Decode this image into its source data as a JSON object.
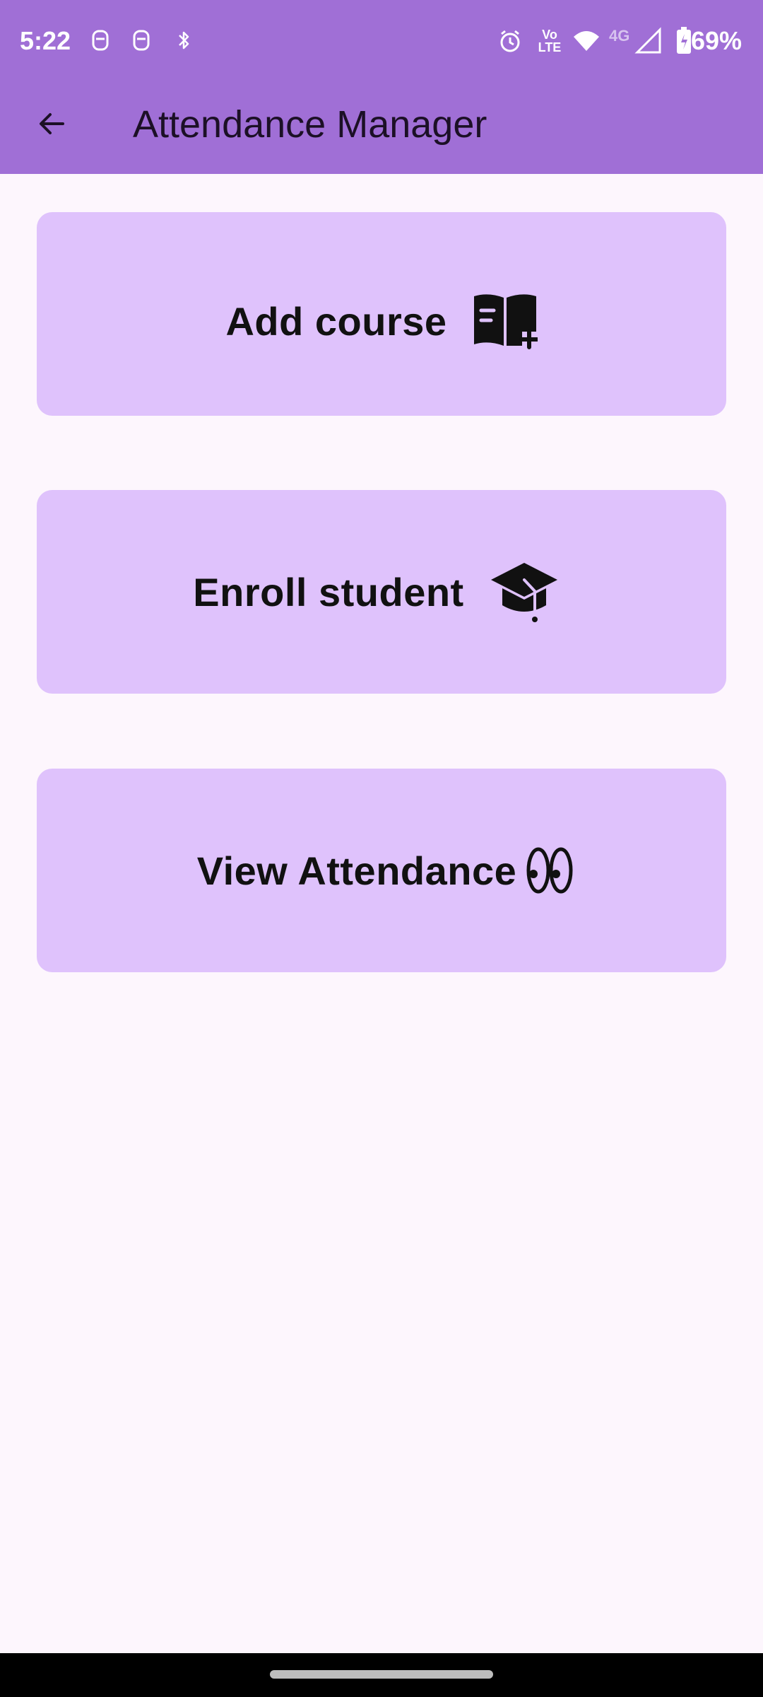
{
  "status_bar": {
    "time": "5:22",
    "network_label": "4G",
    "volte_label": "Vo LTE",
    "battery": "69%"
  },
  "app_bar": {
    "title": "Attendance Manager",
    "back_icon": "arrow-back-icon"
  },
  "menu": [
    {
      "label": "Add course",
      "icon": "book-add-icon"
    },
    {
      "label": "Enroll student",
      "icon": "graduation-cap-icon"
    },
    {
      "label": "View Attendance",
      "icon": "eyes-icon"
    }
  ],
  "colors": {
    "app_bar": "#a06fd6",
    "background": "#fdf6fd",
    "card": "#dfc2fc",
    "text": "#111111"
  }
}
